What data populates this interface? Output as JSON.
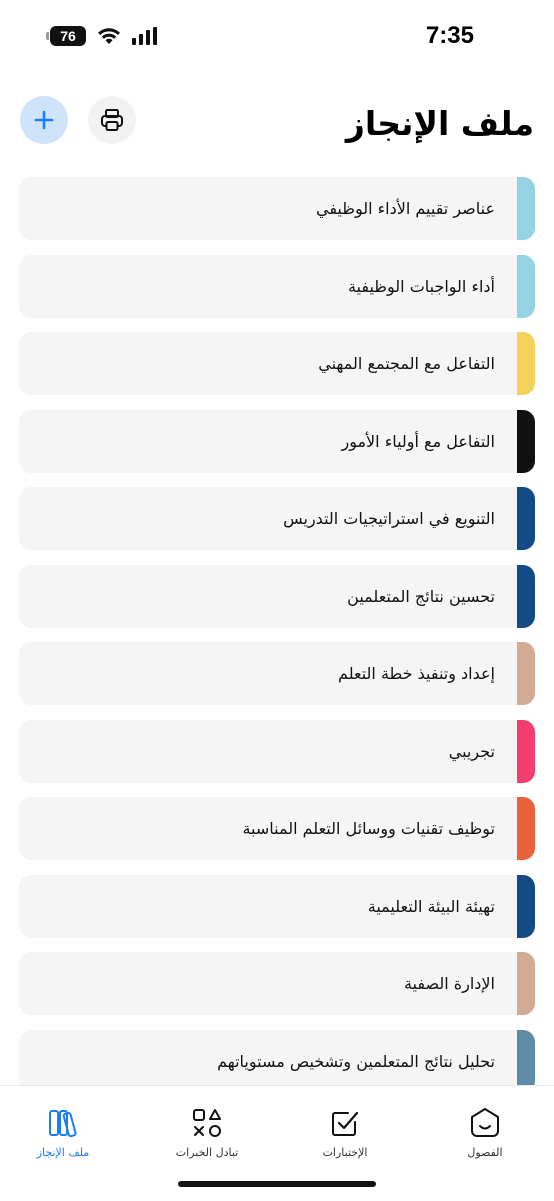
{
  "status": {
    "time": "7:35",
    "battery": "76"
  },
  "header": {
    "title": "ملف الإنجاز"
  },
  "colors": {
    "accent": "#1c7ef0"
  },
  "list": {
    "items": [
      {
        "label": "عناصر تقييم الأداء الوظيفي",
        "color": "#93d3e2"
      },
      {
        "label": "أداء الواجبات الوظيفية",
        "color": "#93d3e2"
      },
      {
        "label": "التفاعل مع المجتمع المهني",
        "color": "#f3d25b"
      },
      {
        "label": "التفاعل مع أولياء الأمور",
        "color": "#111111"
      },
      {
        "label": "التنويع في استراتيجيات التدريس",
        "color": "#144b87"
      },
      {
        "label": "تحسين نتائج المتعلمين",
        "color": "#144b87"
      },
      {
        "label": "إعداد وتنفيذ خطة التعلم",
        "color": "#d2ab92"
      },
      {
        "label": "تجريبي",
        "color": "#f23e6e"
      },
      {
        "label": "توظيف تقنيات ووسائل التعلم المناسبة",
        "color": "#ea623a"
      },
      {
        "label": "تهيئة البيئة التعليمية",
        "color": "#144b87"
      },
      {
        "label": "الإدارة الصفية",
        "color": "#d2ab92"
      },
      {
        "label": "تحليل نتائج المتعلمين وتشخيص مستوياتهم",
        "color": "#5e8ba6"
      }
    ]
  },
  "tabs": [
    {
      "label": "ملف الإنجاز",
      "icon": "portfolio-icon",
      "active": true
    },
    {
      "label": "تبادل الخبرات",
      "icon": "shapes-icon",
      "active": false
    },
    {
      "label": "الإختبارات",
      "icon": "checkbox-icon",
      "active": false
    },
    {
      "label": "الفصول",
      "icon": "classes-icon",
      "active": false
    }
  ]
}
